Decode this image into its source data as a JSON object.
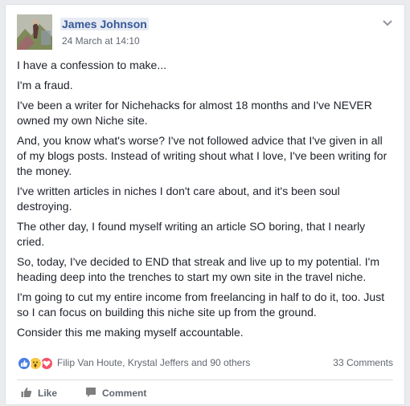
{
  "post": {
    "author": "James Johnson",
    "timestamp": "24 March at 14:10",
    "paragraphs": [
      "I have a confession to make...",
      "I'm a fraud.",
      "I've been a writer for Nichehacks for almost 18 months and I've NEVER owned my own Niche site.",
      "And, you know what's worse? I've not followed advice that I've given in all of my blogs posts. Instead of writing shout what I love, I've been writing for the money.",
      "I've written articles in niches I don't care about, and it's been soul destroying.",
      "The other day, I found myself writing an article SO boring, that I nearly cried.",
      "So, today, I've decided to END that streak and live up to my potential. I'm heading deep into the trenches to start my own site in the travel niche.",
      "I'm going to cut my entire income from freelancing in half to do it, too. Just so I can focus on building this niche site up from the ground.",
      "Consider this me making myself accountable."
    ]
  },
  "engagement": {
    "reaction_icons": [
      "like-reaction-icon",
      "wow-reaction-icon",
      "love-reaction-icon"
    ],
    "reactors": "Filip Van Houte, Krystal Jeffers and 90 others",
    "comments": "33 Comments"
  },
  "actions": {
    "like": "Like",
    "comment": "Comment"
  },
  "colors": {
    "name_link": "#365899",
    "text": "#1d2129",
    "meta": "#616770",
    "like_blue": "#4a7ee3",
    "love_red": "#f25268",
    "wow_yellow": "#f7c843"
  }
}
